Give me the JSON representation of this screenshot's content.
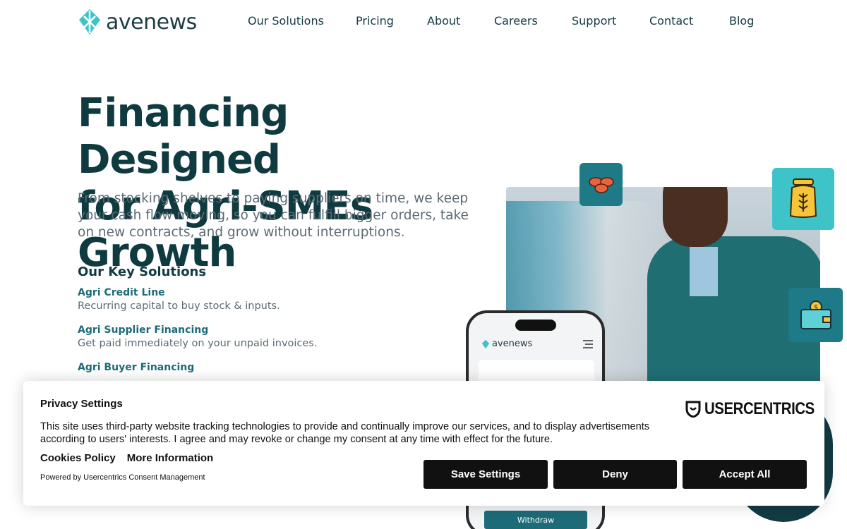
{
  "brand": {
    "name": "avenews",
    "accent": "#3ec3c9",
    "dark": "#0f3b40"
  },
  "nav": {
    "items": [
      "Our Solutions",
      "Pricing",
      "About",
      "Careers",
      "Support",
      "Contact",
      "Blog"
    ]
  },
  "hero": {
    "title_line1": "Financing Designed",
    "title_line2": "for Agri-SMEs Growth",
    "subtitle": "From stocking shelves to paying suppliers on time, we keep your cash flow moving, so you can fulfill bigger orders, take on new contracts, and grow without interruptions."
  },
  "solutions": {
    "heading": "Our Key Solutions",
    "items": [
      {
        "title": "Agri Credit Line",
        "desc": "Recurring capital to buy stock & inputs."
      },
      {
        "title": "Agri Supplier Financing",
        "desc": "Get paid immediately on your unpaid invoices."
      },
      {
        "title": "Agri Buyer Financing",
        "desc": ""
      }
    ]
  },
  "phone": {
    "logo": "avenews",
    "withdraw_label": "Withdraw"
  },
  "consent": {
    "title": "Privacy Settings",
    "text": "This site uses third-party website tracking technologies to provide and continually improve our services, and to display advertisements according to users' interests. I agree and may revoke or change my consent at any time with effect for the future.",
    "links": [
      "Cookies Policy",
      "More Information"
    ],
    "powered_by": "Powered by Usercentrics Consent Management",
    "provider_logo": "USERCENTRICS",
    "buttons": {
      "save": "Save Settings",
      "deny": "Deny",
      "accept": "Accept All"
    }
  },
  "icons": [
    "logo-diamond-icon",
    "beans-icon",
    "grain-bag-icon",
    "wallet-icon",
    "hamburger-menu-icon",
    "usercentrics-shield-icon"
  ]
}
